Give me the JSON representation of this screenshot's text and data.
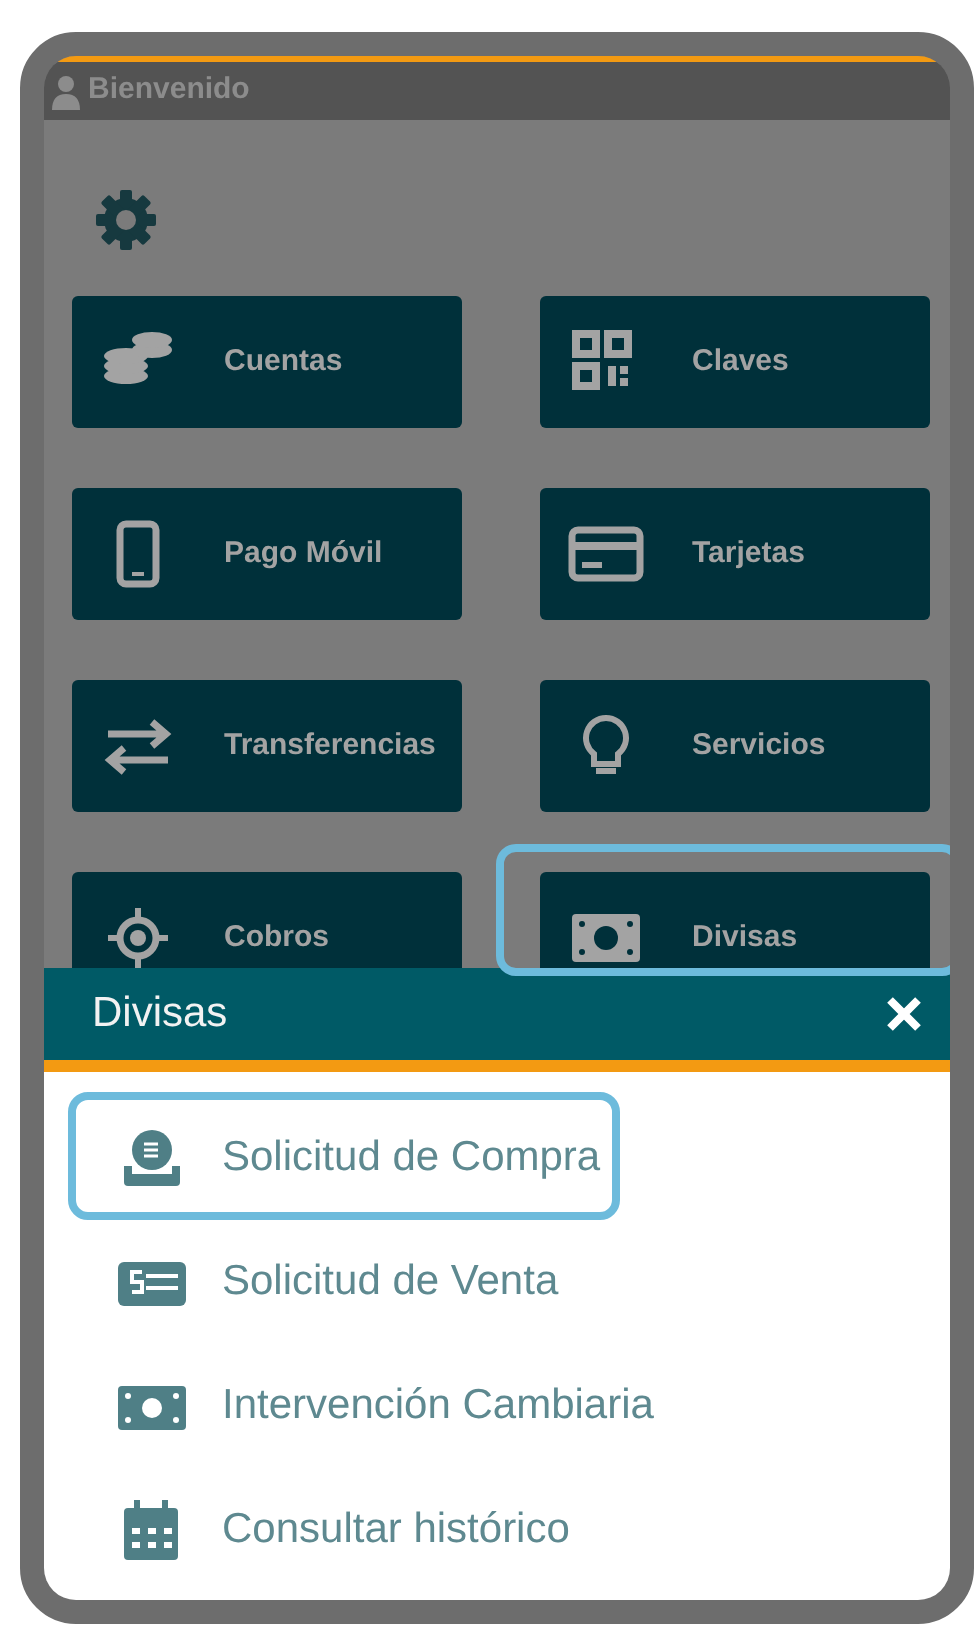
{
  "header": {
    "title": "Bienvenido"
  },
  "tiles": [
    {
      "label": "Cuentas",
      "selected": false
    },
    {
      "label": "Claves",
      "selected": false
    },
    {
      "label": "Pago Móvil",
      "selected": false
    },
    {
      "label": "Tarjetas",
      "selected": false
    },
    {
      "label": "Transferencias",
      "selected": false
    },
    {
      "label": "Servicios",
      "selected": false
    },
    {
      "label": "Cobros",
      "selected": false
    },
    {
      "label": "Divisas",
      "selected": true
    }
  ],
  "sheet": {
    "title": "Divisas",
    "items": [
      {
        "label": "Solicitud de Compra",
        "selected": true
      },
      {
        "label": "Solicitud de Venta",
        "selected": false
      },
      {
        "label": "Intervención Cambiaria",
        "selected": false
      },
      {
        "label": "Consultar histórico",
        "selected": false
      }
    ]
  }
}
